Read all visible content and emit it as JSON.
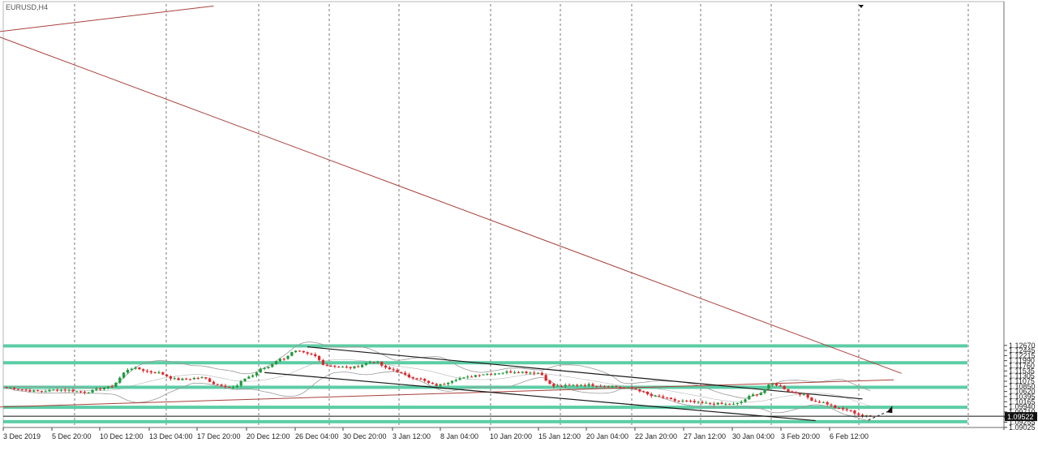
{
  "symbol": "EURUSD,H4",
  "colors": {
    "bull": "#1e9a3a",
    "bear": "#e0252b",
    "zone": "#5ccda5",
    "trend_red": "#a8403b",
    "channel": "#1a1a1a",
    "band": "#9a9a9a",
    "grid": "#7a7a7a"
  },
  "chart_data": {
    "type": "candlestick",
    "ylim": [
      1.0902,
      1.2785
    ],
    "y_ticks": [
      "1.12670",
      "1.12445",
      "1.12215",
      "1.11990",
      "1.11760",
      "1.11535",
      "1.11305",
      "1.11075",
      "1.10850",
      "1.10620",
      "1.10395",
      "1.10165",
      "1.09940",
      "1.09710",
      "1.09480",
      "1.09255",
      "1.09025"
    ],
    "current_price": 1.09522,
    "current_price_label": "1.09522",
    "x_tick_labels": [
      "3 Dec 2019",
      "5 Dec 20:00",
      "10 Dec 12:00",
      "13 Dec 04:00",
      "17 Dec 20:00",
      "20 Dec 12:00",
      "26 Dec 04:00",
      "30 Dec 20:00",
      "3 Jan 12:00",
      "8 Jan 04:00",
      "10 Jan 20:00",
      "15 Jan 12:00",
      "20 Jan 04:00",
      "22 Jan 20:00",
      "27 Jan 12:00",
      "30 Jan 04:00",
      "3 Feb 20:00",
      "6 Feb 12:00"
    ],
    "zones": [
      [
        1.1265,
        1.1272
      ],
      [
        1.1183,
        1.1197
      ],
      [
        1.1075,
        1.1088
      ],
      [
        1.0989,
        1.0999
      ],
      [
        1.0927,
        1.0935
      ]
    ],
    "anchors": [
      [
        0,
        1.1078
      ],
      [
        8,
        1.1063
      ],
      [
        14,
        1.107
      ],
      [
        20,
        1.106
      ],
      [
        26,
        1.108
      ],
      [
        32,
        1.1166
      ],
      [
        38,
        1.1147
      ],
      [
        44,
        1.1115
      ],
      [
        50,
        1.1123
      ],
      [
        54,
        1.1093
      ],
      [
        58,
        1.108
      ],
      [
        62,
        1.1128
      ],
      [
        66,
        1.1166
      ],
      [
        70,
        1.1205
      ],
      [
        74,
        1.124
      ],
      [
        78,
        1.1225
      ],
      [
        82,
        1.1178
      ],
      [
        88,
        1.1168
      ],
      [
        94,
        1.1195
      ],
      [
        98,
        1.116
      ],
      [
        104,
        1.1125
      ],
      [
        110,
        1.109
      ],
      [
        116,
        1.112
      ],
      [
        122,
        1.114
      ],
      [
        130,
        1.115
      ],
      [
        136,
        1.1145
      ],
      [
        140,
        1.1085
      ],
      [
        148,
        1.1092
      ],
      [
        154,
        1.1086
      ],
      [
        160,
        1.1075
      ],
      [
        166,
        1.104
      ],
      [
        172,
        1.102
      ],
      [
        180,
        1.1008
      ],
      [
        186,
        1.1005
      ],
      [
        192,
        1.105
      ],
      [
        196,
        1.1095
      ],
      [
        202,
        1.1055
      ],
      [
        208,
        1.1015
      ],
      [
        214,
        1.0982
      ],
      [
        220,
        1.0952
      ]
    ],
    "trend_lines": [
      {
        "role": "resistance-line",
        "color": "trend_red",
        "p1": [
          -4,
          1.2653
        ],
        "p2": [
          229,
          1.11425
        ]
      },
      {
        "role": "support-line",
        "color": "trend_red",
        "p1": [
          -4,
          1.0992
        ],
        "p2": [
          227,
          1.1114
        ]
      },
      {
        "role": "upper-steep-line",
        "color": "trend_red",
        "p1": [
          -4,
          1.2658
        ],
        "p2": [
          53,
          1.27766
        ]
      },
      {
        "role": "channel-upper-line",
        "color": "channel",
        "p1": [
          77,
          1.12605
        ],
        "p2": [
          219,
          1.1029
        ]
      },
      {
        "role": "channel-lower-line",
        "color": "channel",
        "p1": [
          66,
          1.11465
        ],
        "p2": [
          207,
          1.09325
        ]
      }
    ]
  }
}
